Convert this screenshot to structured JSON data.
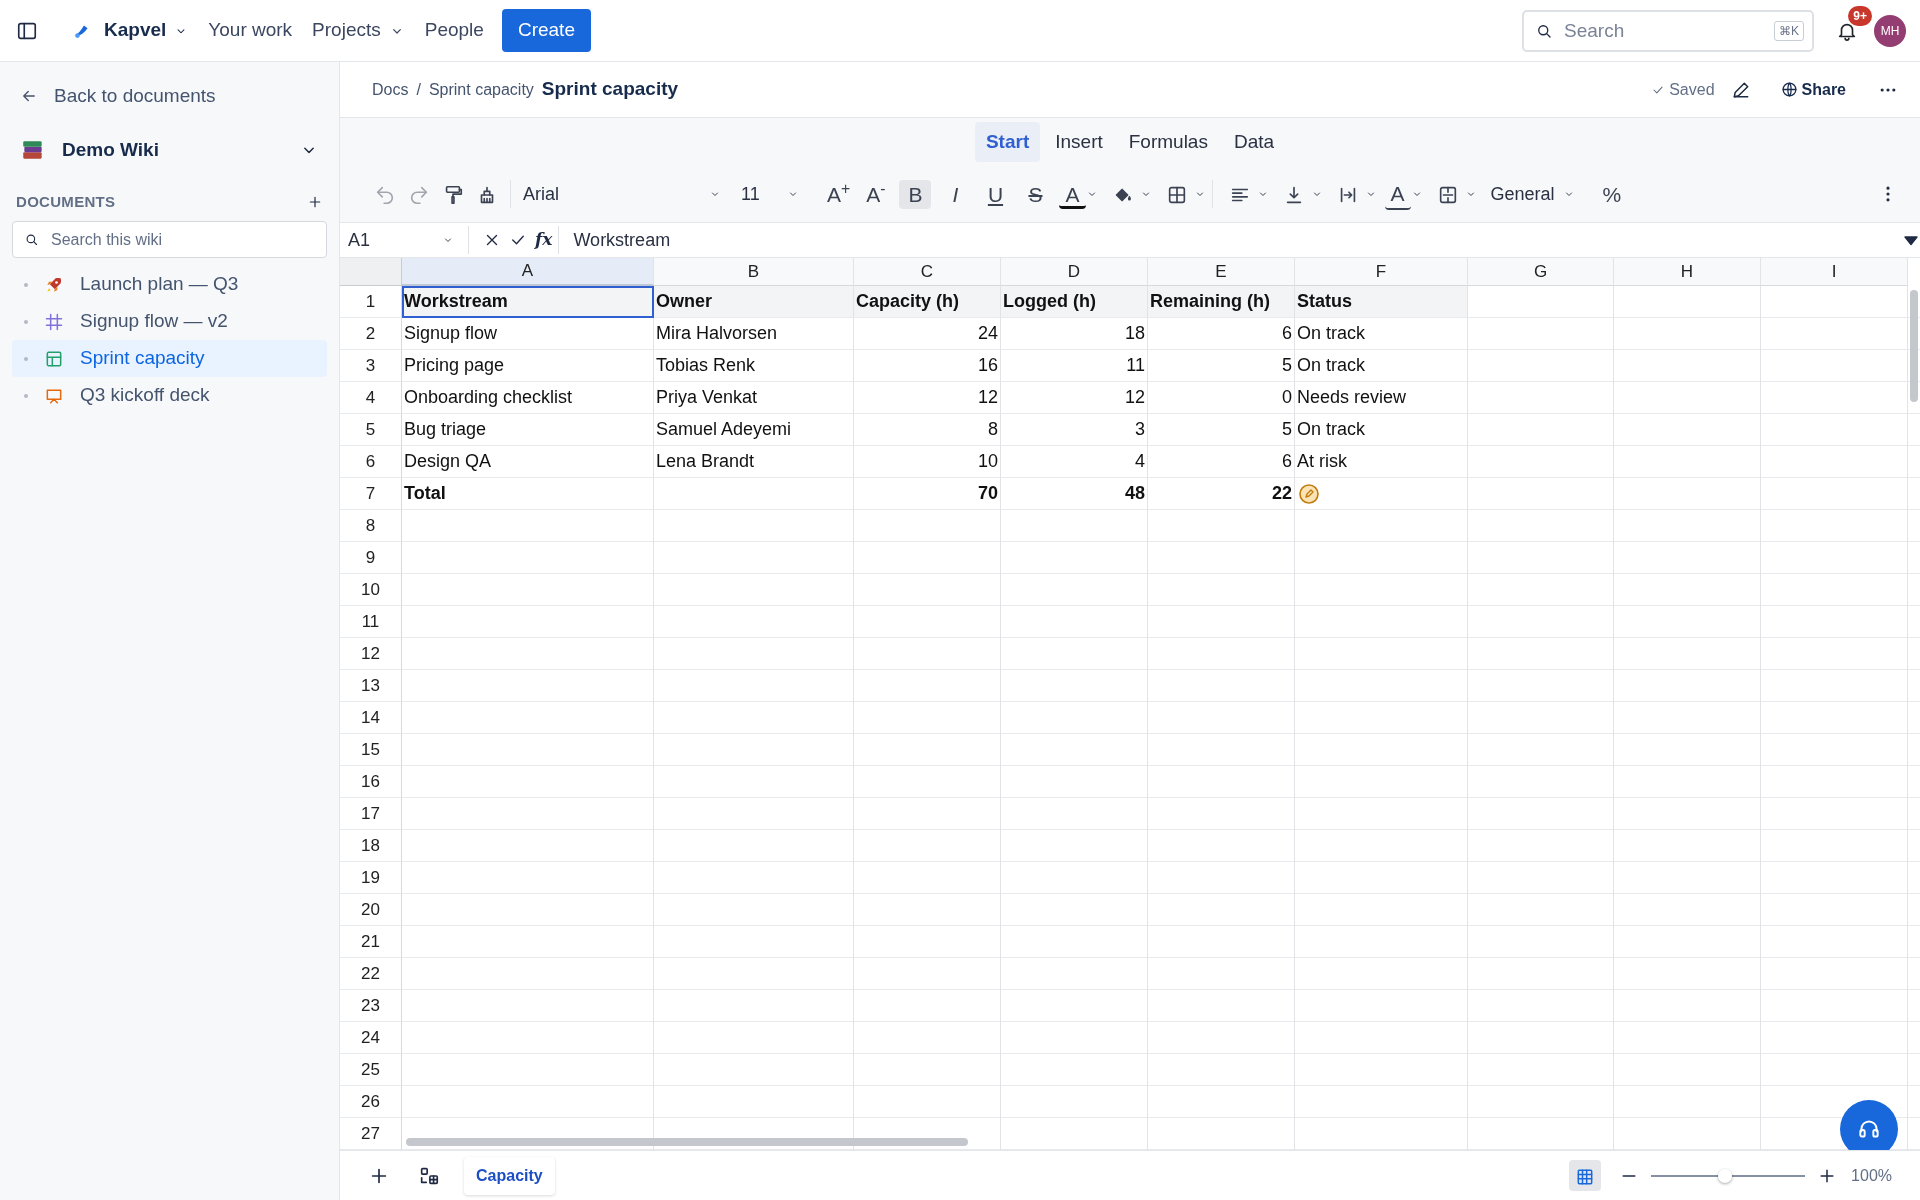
{
  "topbar": {
    "brand": "Kapvel",
    "nav": [
      {
        "label": "Your work",
        "has_menu": false
      },
      {
        "label": "Projects",
        "has_menu": true
      },
      {
        "label": "People",
        "has_menu": false
      }
    ],
    "create": "Create",
    "search": {
      "placeholder": "Search",
      "shortcut": "⌘K"
    },
    "notifications": "9+",
    "avatar": "MH"
  },
  "sidebar": {
    "back": "Back to documents",
    "space": "Demo Wiki",
    "section": "DOCUMENTS",
    "search": {
      "placeholder": "Search this wiki"
    },
    "items": [
      {
        "label": "Launch plan — Q3",
        "kind": "rocket",
        "selected": false
      },
      {
        "label": "Signup flow — v2",
        "kind": "frame",
        "selected": false
      },
      {
        "label": "Sprint capacity",
        "kind": "sheet",
        "selected": true
      },
      {
        "label": "Q3 kickoff deck",
        "kind": "slides",
        "selected": false
      }
    ]
  },
  "doc": {
    "breadcrumbs": [
      "Docs",
      "Sprint capacity"
    ],
    "separator": "/",
    "title": "Sprint capacity",
    "saved": "Saved",
    "share": "Share"
  },
  "ribbon_tabs": [
    {
      "label": "Start",
      "selected": true
    },
    {
      "label": "Insert",
      "selected": false
    },
    {
      "label": "Formulas",
      "selected": false
    },
    {
      "label": "Data",
      "selected": false
    }
  ],
  "toolbar": {
    "font": "Arial",
    "size": "11",
    "grow": "A$^{+}$",
    "shrink": "A$^{-}$",
    "styles": [
      {
        "label": "B",
        "active": true
      },
      {
        "label": "I",
        "active": false
      },
      {
        "label": "U",
        "active": false
      },
      {
        "label": "S",
        "active": false
      }
    ],
    "text_color": "A",
    "rotate": "A",
    "format": "General",
    "percent": "%"
  },
  "formula_bar": {
    "cell": "A1",
    "fx": "fx",
    "value": "Workstream"
  },
  "sheet": {
    "columns": [
      {
        "label": "A",
        "selected": true
      },
      {
        "label": "B",
        "selected": false
      },
      {
        "label": "C",
        "selected": false
      },
      {
        "label": "D",
        "selected": false
      },
      {
        "label": "E",
        "selected": false
      },
      {
        "label": "F",
        "selected": false
      },
      {
        "label": "G",
        "selected": false
      },
      {
        "label": "H",
        "selected": false
      },
      {
        "label": "I",
        "selected": false
      }
    ],
    "row_numbers": [
      "1",
      "2",
      "3",
      "4",
      "5",
      "6",
      "7",
      "8",
      "9",
      "10",
      "11",
      "12",
      "13",
      "14",
      "15",
      "16",
      "17",
      "18",
      "19",
      "20",
      "21",
      "22",
      "23",
      "24",
      "25",
      "26",
      "27"
    ],
    "rows": [
      {
        "kind": "header",
        "cells": [
          {
            "kind": "text",
            "text": "Workstream",
            "selected": true
          },
          {
            "kind": "text",
            "text": "Owner",
            "selected": false
          },
          {
            "kind": "text",
            "text": "Capacity (h)",
            "selected": false
          },
          {
            "kind": "text",
            "text": "Logged (h)",
            "selected": false
          },
          {
            "kind": "text",
            "text": "Remaining (h)",
            "selected": false
          },
          {
            "kind": "text",
            "text": "Status",
            "selected": false
          }
        ]
      },
      {
        "kind": "data",
        "cells": [
          {
            "kind": "text",
            "text": "Signup flow",
            "selected": false
          },
          {
            "kind": "text",
            "text": "Mira Halvorsen",
            "selected": false
          },
          {
            "kind": "number",
            "text": "24",
            "selected": false
          },
          {
            "kind": "number",
            "text": "18",
            "selected": false
          },
          {
            "kind": "number",
            "text": "6",
            "selected": false
          },
          {
            "kind": "text",
            "text": "On track",
            "selected": false
          }
        ]
      },
      {
        "kind": "data",
        "cells": [
          {
            "kind": "text",
            "text": "Pricing page",
            "selected": false
          },
          {
            "kind": "text",
            "text": "Tobias Renk",
            "selected": false
          },
          {
            "kind": "number",
            "text": "16",
            "selected": false
          },
          {
            "kind": "number",
            "text": "11",
            "selected": false
          },
          {
            "kind": "number",
            "text": "5",
            "selected": false
          },
          {
            "kind": "text",
            "text": "On track",
            "selected": false
          }
        ]
      },
      {
        "kind": "data",
        "cells": [
          {
            "kind": "text",
            "text": "Onboarding checklist",
            "selected": false
          },
          {
            "kind": "text",
            "text": "Priya Venkat",
            "selected": false
          },
          {
            "kind": "number",
            "text": "12",
            "selected": false
          },
          {
            "kind": "number",
            "text": "12",
            "selected": false
          },
          {
            "kind": "number",
            "text": "0",
            "selected": false
          },
          {
            "kind": "text",
            "text": "Needs review",
            "selected": false
          }
        ]
      },
      {
        "kind": "data",
        "cells": [
          {
            "kind": "text",
            "text": "Bug triage",
            "selected": false
          },
          {
            "kind": "text",
            "text": "Samuel Adeyemi",
            "selected": false
          },
          {
            "kind": "number",
            "text": "8",
            "selected": false
          },
          {
            "kind": "number",
            "text": "3",
            "selected": false
          },
          {
            "kind": "number",
            "text": "5",
            "selected": false
          },
          {
            "kind": "text",
            "text": "On track",
            "selected": false
          }
        ]
      },
      {
        "kind": "data",
        "cells": [
          {
            "kind": "text",
            "text": "Design QA",
            "selected": false
          },
          {
            "kind": "text",
            "text": "Lena Brandt",
            "selected": false
          },
          {
            "kind": "number",
            "text": "10",
            "selected": false
          },
          {
            "kind": "number",
            "text": "4",
            "selected": false
          },
          {
            "kind": "number",
            "text": "6",
            "selected": false
          },
          {
            "kind": "text",
            "text": "At risk",
            "selected": false
          }
        ]
      },
      {
        "kind": "total",
        "cells": [
          {
            "kind": "text",
            "text": "Total",
            "selected": false
          },
          {
            "kind": "empty"
          },
          {
            "kind": "number",
            "text": "70",
            "selected": false
          },
          {
            "kind": "number",
            "text": "48",
            "selected": false
          },
          {
            "kind": "number",
            "text": "22",
            "selected": false
          },
          {
            "kind": "note",
            "selected": false
          }
        ]
      }
    ]
  },
  "sheet_tabs": [
    {
      "label": "Capacity",
      "selected": true
    }
  ],
  "zoom": {
    "level": 0.48,
    "reading": "100%"
  }
}
